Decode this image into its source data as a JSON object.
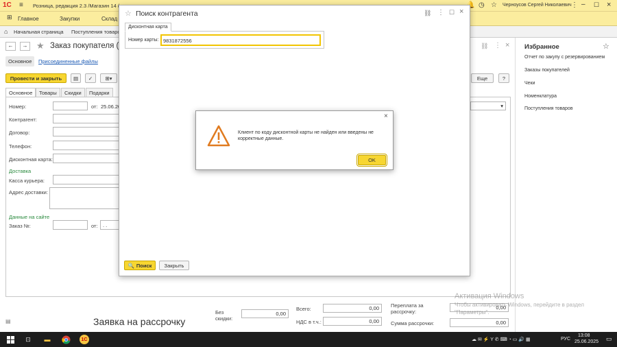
{
  "titlebar": {
    "logo": "1С",
    "title": "Розница, редакция 2.3 /Магазин 14 (",
    "user": "Черноусов Сергей Николаевич",
    "icons": [
      "bell-icon",
      "history-icon",
      "star-icon",
      "menu-icon",
      "minimize-icon",
      "maximize-icon",
      "close-icon"
    ]
  },
  "menubar": {
    "items": [
      "Главное",
      "Закупки",
      "Склад"
    ]
  },
  "tabbar": {
    "home": "Начальная страница",
    "tab2": "Поступления товаро"
  },
  "document": {
    "title": "Заказ покупателя (со",
    "nav_tabs": [
      "Основное",
      "Присоединенные файлы"
    ],
    "post_close": "Провести и закрыть",
    "more": "Еще",
    "help": "?",
    "subtabs": [
      "Основное",
      "Товары",
      "Скидки",
      "Подарки"
    ],
    "labels": {
      "number": "Номер:",
      "from": "от:",
      "date": "25.06.20",
      "contractor": "Контрагент:",
      "contract": "Договор:",
      "phone": "Телефон:",
      "card": "Дисконтная карта:",
      "delivery": "Доставка",
      "courier": "Касса курьера:",
      "address": "Адрес доставки:",
      "site_data": "Данные на сайте",
      "order_no": "Заказ №:",
      "from2": "от:",
      "date2": ". ."
    }
  },
  "footer": {
    "installment": "Заявка на рассрочку",
    "without_discount": "Без скидки:",
    "without_discount_value": "0,00",
    "total": "Всего:",
    "total_value": "0,00",
    "vat": "НДС в т.ч.:",
    "vat_value": "0,00",
    "overpay": "Переплата за рассрочку:",
    "overpay_value": "0,00",
    "installment_sum": "Сумма рассрочки:",
    "installment_sum_value": "0,00"
  },
  "favorites": {
    "title": "Избранное",
    "items": [
      "Отчет по закупу с резервированием",
      "Заказы покупателей",
      "Чеки",
      "Номенклатура",
      "Поступления товаров"
    ]
  },
  "search_dialog": {
    "title": "Поиск контрагента",
    "tab": "Дисконтная карта",
    "card_label": "Номер карты:",
    "card_value": "9831872556",
    "search_button": "Поиск",
    "close_button": "Закрыть"
  },
  "alert": {
    "message": "Клиент по коду дисконтной карты не найден или введены не корректные данные.",
    "ok": "OK"
  },
  "watermark": {
    "line1": "Активация Windows",
    "line2": "Чтобы активировать Windows, перейдите в раздел",
    "line3": "\"Параметры\"."
  },
  "taskbar": {
    "lang": "РУС",
    "time": "13:08",
    "date": "25.06.2025"
  }
}
